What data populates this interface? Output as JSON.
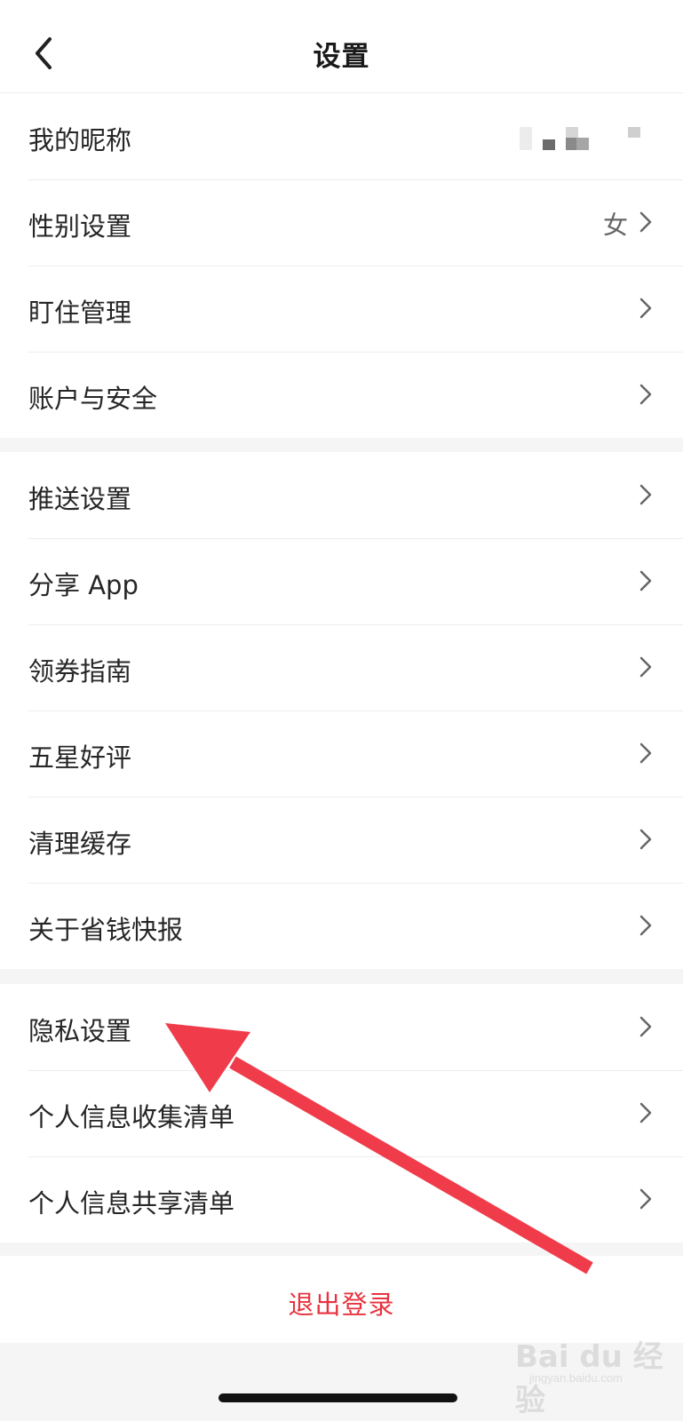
{
  "header": {
    "title": "设置",
    "back_icon": "chevron-left-icon"
  },
  "group1": [
    {
      "label": "我的昵称",
      "value": "",
      "nickname_masked": true
    },
    {
      "label": "性别设置",
      "value": "女"
    },
    {
      "label": "盯住管理",
      "value": ""
    },
    {
      "label": "账户与安全",
      "value": ""
    }
  ],
  "group2": [
    {
      "label": "推送设置"
    },
    {
      "label": "分享 App"
    },
    {
      "label": "领券指南"
    },
    {
      "label": "五星好评"
    },
    {
      "label": "清理缓存"
    },
    {
      "label": "关于省钱快报"
    }
  ],
  "group3": [
    {
      "label": "隐私设置"
    },
    {
      "label": "个人信息收集清单"
    },
    {
      "label": "个人信息共享清单"
    }
  ],
  "logout": {
    "label": "退出登录"
  },
  "watermark": {
    "main": "Bai du 经验",
    "sub": "jingyan.baidu.com"
  },
  "colors": {
    "background": "#f5f5f5",
    "card": "#ffffff",
    "logout_text": "#e8333f",
    "annotation_arrow": "#f03c4a"
  }
}
